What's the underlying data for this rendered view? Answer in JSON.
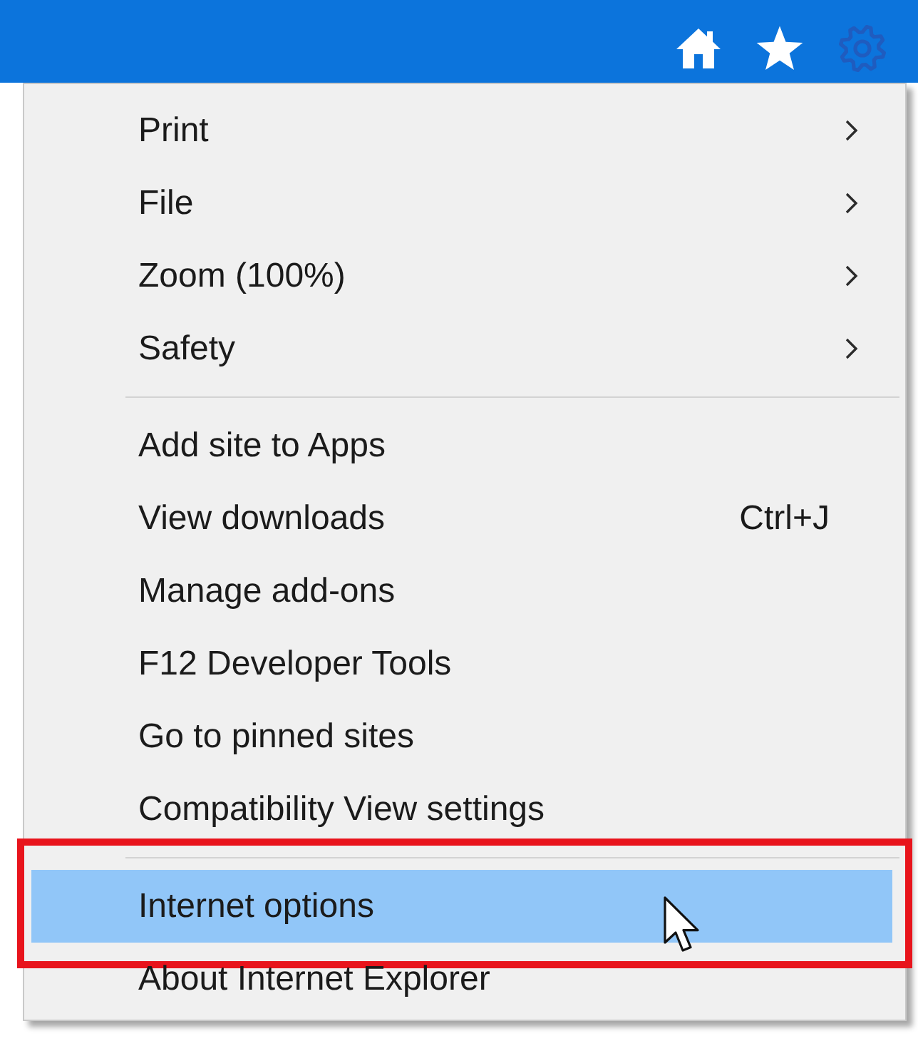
{
  "toolbar": {
    "buttons": [
      {
        "kind": "home",
        "active": false
      },
      {
        "kind": "star",
        "active": false
      },
      {
        "kind": "gear",
        "active": true
      }
    ]
  },
  "menu": {
    "groups": [
      {
        "items": [
          {
            "label": "Print",
            "submenu": true,
            "selected": false,
            "annotated": false,
            "pointer": false
          },
          {
            "label": "File",
            "submenu": true,
            "selected": false,
            "annotated": false,
            "pointer": false
          },
          {
            "label": "Zoom (100%)",
            "submenu": true,
            "selected": false,
            "annotated": false,
            "pointer": false
          },
          {
            "label": "Safety",
            "submenu": true,
            "selected": false,
            "annotated": false,
            "pointer": false
          }
        ]
      },
      {
        "items": [
          {
            "label": "Add site to Apps",
            "submenu": false,
            "selected": false,
            "annotated": false,
            "pointer": false
          },
          {
            "label": "View downloads",
            "shortcut": "Ctrl+J",
            "submenu": false,
            "selected": false,
            "annotated": false,
            "pointer": false
          },
          {
            "label": "Manage add-ons",
            "submenu": false,
            "selected": false,
            "annotated": false,
            "pointer": false
          },
          {
            "label": "F12 Developer Tools",
            "submenu": false,
            "selected": false,
            "annotated": false,
            "pointer": false
          },
          {
            "label": "Go to pinned sites",
            "submenu": false,
            "selected": false,
            "annotated": false,
            "pointer": false
          },
          {
            "label": "Compatibility View settings",
            "submenu": false,
            "selected": false,
            "annotated": false,
            "pointer": false
          }
        ]
      },
      {
        "items": [
          {
            "label": "Internet options",
            "submenu": false,
            "selected": true,
            "annotated": true,
            "pointer": true
          },
          {
            "label": "About Internet Explorer",
            "submenu": false,
            "selected": false,
            "annotated": false,
            "pointer": false
          }
        ]
      }
    ]
  }
}
